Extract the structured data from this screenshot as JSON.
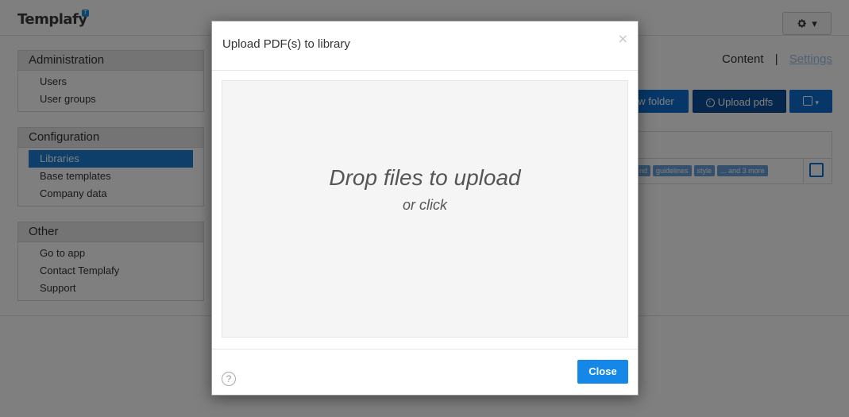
{
  "app": {
    "logo_text": "Templafy",
    "logo_badge": "T"
  },
  "header": {
    "settings_caret": "▾"
  },
  "sidebar": {
    "sections": [
      {
        "title": "Administration",
        "items": [
          {
            "label": "Users",
            "active": false
          },
          {
            "label": "User groups",
            "active": false
          }
        ]
      },
      {
        "title": "Configuration",
        "items": [
          {
            "label": "Libraries",
            "active": true
          },
          {
            "label": "Base templates",
            "active": false
          },
          {
            "label": "Company data",
            "active": false
          }
        ]
      },
      {
        "title": "Other",
        "items": [
          {
            "label": "Go to app",
            "active": false
          },
          {
            "label": "Contact Templafy",
            "active": false
          },
          {
            "label": "Support",
            "active": false
          }
        ]
      }
    ]
  },
  "main": {
    "content_link": "Content",
    "separator": "|",
    "settings_link": "Settings",
    "new_folder_label": "w folder",
    "upload_label": "Upload pdfs",
    "tags": [
      "nd",
      "guidelines",
      "style",
      "... and 3 more"
    ]
  },
  "modal": {
    "title": "Upload PDF(s) to library",
    "close_x": "×",
    "drop_main": "Drop files to upload",
    "drop_sub": "or click",
    "help_glyph": "?",
    "close_button": "Close"
  },
  "colors": {
    "primary": "#0d6fd1",
    "active_item": "#1a7fd4",
    "close_button": "#1487e8",
    "overlay": "rgba(0,0,0,0.5)"
  }
}
